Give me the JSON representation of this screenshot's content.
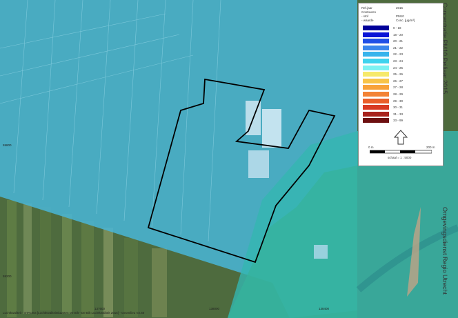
{
  "titles": {
    "top": "Concentratie PM10 Peiljaar 2015",
    "bottom": "Omgevingsdienst Regio Utrecht"
  },
  "legend": {
    "refjaar_label": "Ref.jaar",
    "refjaar_value": "2015",
    "contouren_label": "Contouren",
    "contour_1": "- stof",
    "contour_2": "- waarde",
    "component": "PM10",
    "unit": "Conc. [µg/m³]",
    "classes": [
      {
        "label": "0 - 18",
        "color": "#000099"
      },
      {
        "label": "18 - 20",
        "color": "#0a14d6"
      },
      {
        "label": "20 - 21",
        "color": "#1f4fe6"
      },
      {
        "label": "21 - 22",
        "color": "#3a86ec"
      },
      {
        "label": "22 - 23",
        "color": "#38b4ec"
      },
      {
        "label": "23 - 24",
        "color": "#3fd3ee"
      },
      {
        "label": "24 - 25",
        "color": "#7ef2f2"
      },
      {
        "label": "25 - 26",
        "color": "#f6e96a"
      },
      {
        "label": "26 - 27",
        "color": "#f8c449"
      },
      {
        "label": "27 - 28",
        "color": "#f8a23a"
      },
      {
        "label": "28 - 29",
        "color": "#f38235"
      },
      {
        "label": "29 - 30",
        "color": "#ea5f2a"
      },
      {
        "label": "30 - 31",
        "color": "#d83a22"
      },
      {
        "label": "31 - 33",
        "color": "#a8221c"
      },
      {
        "label": "33 - 99",
        "color": "#6d0f10"
      }
    ],
    "scale_start": "0 m",
    "scale_end": "200 m",
    "scale_text": "schaal = 1 : 5000",
    "north_icon": "north-arrow-icon"
  },
  "coords": {
    "x1": "137600",
    "x2": "138000",
    "x3": "138400",
    "y1": "59800",
    "y2": "59200"
  },
  "footer": "Luchtkwaliteit - STACKS [Luchtkwaliteitskaarten De Bilt - De Bilt Luchtkwaliteit 2015] - Geomilieu V2.60",
  "colors": {
    "overlay_main": "#49b6d8",
    "overlay_south": "#34b7b0",
    "overlay_east": "#35b39c",
    "boundary": "#000000"
  }
}
